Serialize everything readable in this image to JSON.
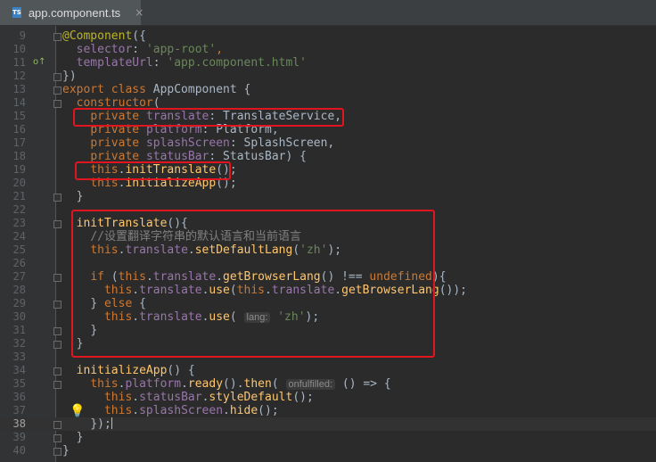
{
  "tab": {
    "title": "app.component.ts",
    "badge": "TS",
    "close": "×"
  },
  "gutter": {
    "override_marker": "o↑",
    "bulb": "💡"
  },
  "lines": [
    {
      "n": "9"
    },
    {
      "n": "10"
    },
    {
      "n": "11"
    },
    {
      "n": "12"
    },
    {
      "n": "13"
    },
    {
      "n": "14"
    },
    {
      "n": "15"
    },
    {
      "n": "16"
    },
    {
      "n": "17"
    },
    {
      "n": "18"
    },
    {
      "n": "19"
    },
    {
      "n": "20"
    },
    {
      "n": "21"
    },
    {
      "n": "22"
    },
    {
      "n": "23"
    },
    {
      "n": "24"
    },
    {
      "n": "25"
    },
    {
      "n": "26"
    },
    {
      "n": "27"
    },
    {
      "n": "28"
    },
    {
      "n": "29"
    },
    {
      "n": "30"
    },
    {
      "n": "31"
    },
    {
      "n": "32"
    },
    {
      "n": "33"
    },
    {
      "n": "34"
    },
    {
      "n": "35"
    },
    {
      "n": "36"
    },
    {
      "n": "37"
    },
    {
      "n": "38"
    },
    {
      "n": "39"
    },
    {
      "n": "40"
    }
  ],
  "code": {
    "l9": [
      "@Component",
      "({"
    ],
    "l10": [
      "selector",
      ": ",
      "'app-root'",
      ","
    ],
    "l11": [
      "templateUrl",
      ": ",
      "'app.component.html'"
    ],
    "l12": [
      "})"
    ],
    "l13": [
      "export class ",
      "AppComponent {"
    ],
    "l14": [
      "constructor",
      "("
    ],
    "l15": [
      "private ",
      "translate",
      ": TranslateService,"
    ],
    "l16": [
      "private ",
      "platform",
      ": Platform,"
    ],
    "l17": [
      "private ",
      "splashScreen",
      ": SplashScreen,"
    ],
    "l18": [
      "private ",
      "statusBar",
      ": StatusBar) {"
    ],
    "l19": [
      "this",
      ".",
      "initTranslate",
      "();"
    ],
    "l20": [
      "this",
      ".",
      "initializeApp",
      "();"
    ],
    "l21": [
      "}"
    ],
    "l23": [
      "initTranslate",
      "(){"
    ],
    "l24": [
      "//设置翻译字符串的默认语言和当前语言"
    ],
    "l25": [
      "this",
      ".",
      "translate",
      ".",
      "setDefaultLang",
      "(",
      "'zh'",
      ");"
    ],
    "l27": [
      "if ",
      "(",
      "this",
      ".",
      "translate",
      ".",
      "getBrowserLang",
      "() !== ",
      "undefined",
      "){"
    ],
    "l28": [
      "this",
      ".",
      "translate",
      ".",
      "use",
      "(",
      "this",
      ".",
      "translate",
      ".",
      "getBrowserLang",
      "());"
    ],
    "l29": [
      "} ",
      "else ",
      "{"
    ],
    "l30": [
      "this",
      ".",
      "translate",
      ".",
      "use",
      "(",
      "lang:",
      "'zh'",
      ");"
    ],
    "l31": [
      "}"
    ],
    "l32": [
      "}"
    ],
    "l34": [
      "initializeApp",
      "() {"
    ],
    "l35": [
      "this",
      ".",
      "platform",
      ".",
      "ready",
      "().",
      "then",
      "(",
      "onfulfilled:",
      "() => {"
    ],
    "l36": [
      "this",
      ".",
      "statusBar",
      ".",
      "styleDefault",
      "();"
    ],
    "l37": [
      "this",
      ".",
      "splashScreen",
      ".",
      "hide",
      "();"
    ],
    "l38": [
      "});"
    ],
    "l39": [
      "}"
    ],
    "l40": [
      "}"
    ]
  }
}
